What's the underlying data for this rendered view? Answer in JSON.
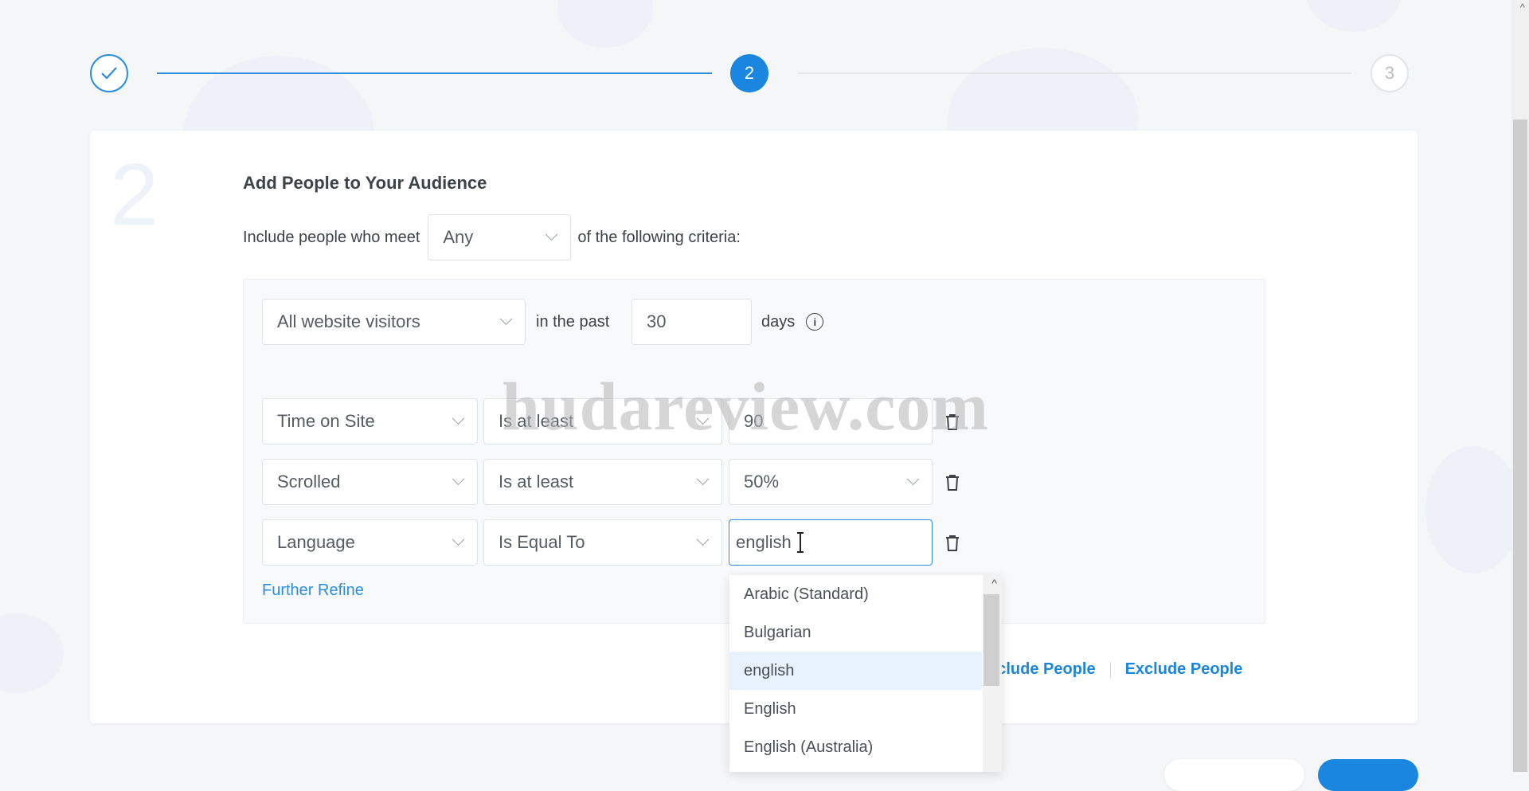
{
  "stepper": {
    "step2_label": "2",
    "step3_label": "3"
  },
  "card": {
    "step_number": "2",
    "title": "Add People to Your Audience",
    "include_prefix": "Include people who meet",
    "match_select": "Any",
    "include_suffix": "of the following criteria:"
  },
  "visitors_rule": {
    "source_select": "All website visitors",
    "in_the_past": "in the past",
    "days_value": "30",
    "days_label": "days"
  },
  "rules": [
    {
      "field": "Time on Site",
      "operator": "Is at least",
      "value": "90"
    },
    {
      "field": "Scrolled",
      "operator": "Is at least",
      "value": "50%"
    },
    {
      "field": "Language",
      "operator": "Is Equal To",
      "value": "english"
    }
  ],
  "further_refine": "Further Refine",
  "actions": {
    "include_people": "nclude People",
    "exclude_people": "Exclude People"
  },
  "dropdown": {
    "items": [
      "Arabic (Standard)",
      "Bulgarian",
      "english",
      "English",
      "English (Australia)"
    ],
    "highlighted": "english"
  },
  "watermark": "hudareview.com",
  "colors": {
    "accent": "#1a86e0",
    "line_done": "#2a8ee0",
    "line_pending": "#e4e6ea"
  }
}
